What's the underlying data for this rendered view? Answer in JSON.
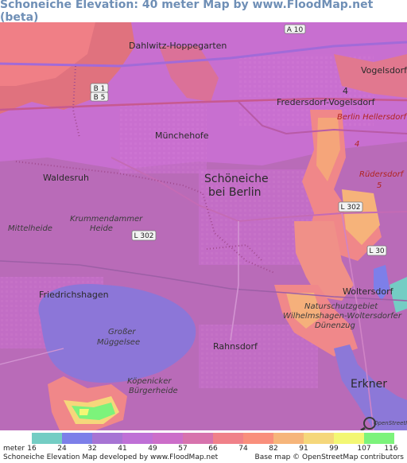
{
  "title": "Schoneiche Elevation: 40 meter Map by www.FloodMap.net (beta)",
  "map": {
    "places": [
      {
        "id": "dahlwitz",
        "label": "Dahlwitz-Hoppegarten"
      },
      {
        "id": "vogelsdorf",
        "label": "Vogelsdorf"
      },
      {
        "id": "fredersdorf",
        "label": "Fredersdorf-Vogelsdorf"
      },
      {
        "id": "berlin-hellersdorf",
        "label": "Berlin Hellersdorf"
      },
      {
        "id": "muenchehofe",
        "label": "Münchehofe"
      },
      {
        "id": "waldesruh",
        "label": "Waldesruh"
      },
      {
        "id": "schoeneiche-1",
        "label": "Schöneiche"
      },
      {
        "id": "schoeneiche-2",
        "label": "bei Berlin"
      },
      {
        "id": "ruedersdorf",
        "label": "Rüdersdorf"
      },
      {
        "id": "mittelheide",
        "label": "Mittelheide"
      },
      {
        "id": "krummendammer-1",
        "label": "Krummendammer"
      },
      {
        "id": "krummendammer-2",
        "label": "Heide"
      },
      {
        "id": "friedrichshagen",
        "label": "Friedrichshagen"
      },
      {
        "id": "woltersdorf",
        "label": "Woltersdorf"
      },
      {
        "id": "nsg-1",
        "label": "Naturschutzgebiet"
      },
      {
        "id": "nsg-2",
        "label": "Wilhelmshagen-Woltersdorfer"
      },
      {
        "id": "nsg-3",
        "label": "Dünenzug"
      },
      {
        "id": "mueggelsee-1",
        "label": "Großer"
      },
      {
        "id": "mueggelsee-2",
        "label": "Müggelsee"
      },
      {
        "id": "rahnsdorf",
        "label": "Rahnsdorf"
      },
      {
        "id": "koepenicker-1",
        "label": "Köpenicker"
      },
      {
        "id": "koepenicker-2",
        "label": "Bürgerheide"
      },
      {
        "id": "erkner",
        "label": "Erkner"
      }
    ],
    "road_shields": [
      {
        "id": "a10",
        "label": "A 10"
      },
      {
        "id": "b1",
        "label": "B 1"
      },
      {
        "id": "b5",
        "label": "B 5"
      },
      {
        "id": "l302-east",
        "label": "L 302"
      },
      {
        "id": "l302-west",
        "label": "L 302"
      },
      {
        "id": "l30",
        "label": "L 30"
      }
    ],
    "route_numbers": [
      {
        "id": "r4a",
        "label": "4"
      },
      {
        "id": "r4b",
        "label": "4"
      },
      {
        "id": "r5",
        "label": "5"
      }
    ],
    "osm_logo_text": "OpenStreetMap"
  },
  "legend": {
    "unit_label": "meter",
    "colors": [
      "#74cdc4",
      "#7d7fe9",
      "#a774d4",
      "#bf70d6",
      "#cc6ec9",
      "#d773ad",
      "#f08189",
      "#f98f7c",
      "#f6b57a",
      "#f5d77b",
      "#f3f774",
      "#7cf37b",
      "#83df84"
    ],
    "values": [
      "16",
      "24",
      "32",
      "41",
      "49",
      "57",
      "66",
      "74",
      "82",
      "91",
      "99",
      "107",
      "116"
    ]
  },
  "footer": {
    "left": "Schoneiche Elevation Map developed by www.FloodMap.net",
    "right": "Base map © OpenStreetMap contributors"
  }
}
